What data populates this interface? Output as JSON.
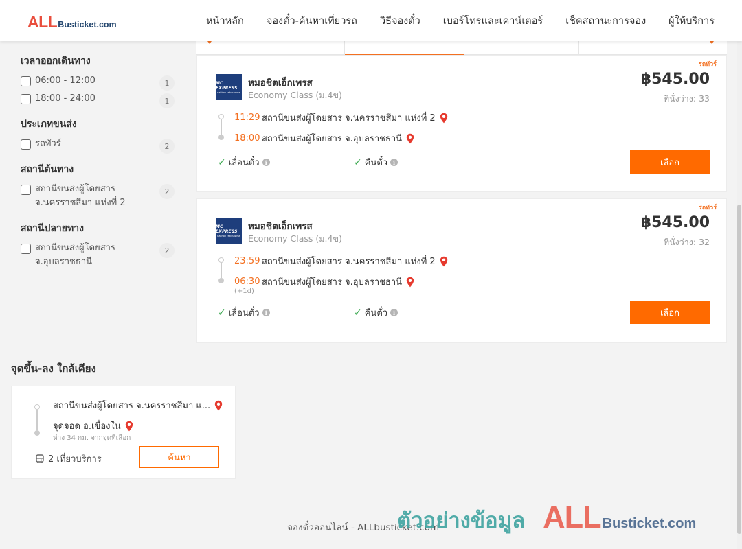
{
  "header": {
    "logo_all": "ALL",
    "logo_rest": "Busticket.com",
    "nav": [
      "หน้าหลัก",
      "จองตั๋ว-ค้นหาเที่ยวรถ",
      "วิธีจองตั๋ว",
      "เบอร์โทรและเคาน์เตอร์",
      "เช็คสถานะการจอง",
      "ผู้ให้บริการ"
    ]
  },
  "filters": {
    "departure_time": {
      "title": "เวลาออกเดินทาง",
      "options": [
        {
          "label": "06:00 - 12:00",
          "count": "1"
        },
        {
          "label": "18:00 - 24:00",
          "count": "1"
        }
      ]
    },
    "transport_type": {
      "title": "ประเภทขนส่ง",
      "options": [
        {
          "label": "รถทัวร์",
          "count": "2"
        }
      ]
    },
    "origin": {
      "title": "สถานีต้นทาง",
      "options": [
        {
          "label": "สถานีขนส่งผู้โดยสาร จ.นครราชสีมา แห่งที่ 2",
          "count": "2"
        }
      ]
    },
    "destination": {
      "title": "สถานีปลายทาง",
      "options": [
        {
          "label": "สถานีขนส่งผู้โดยสาร จ.อุบลราชธานี",
          "count": "2"
        }
      ]
    }
  },
  "trips": [
    {
      "type_badge": "รถทัวร์",
      "operator_logo_l1": "MC EXPRESS",
      "operator_logo_l2": "nakhon ratchasima",
      "operator": "หมอชิตเอ็กเพรส",
      "class": "Economy Class (ม.4ข)",
      "price": "฿545.00",
      "seats": "ที่นั่งว่าง: 33",
      "depart_time": "11:29",
      "depart_station": "สถานีขนส่งผู้โดยสาร จ.นครราชสีมา แห่งที่ 2",
      "arrive_time": "18:00",
      "arrive_station": "สถานีขนส่งผู้โดยสาร จ.อุบลราชธานี",
      "arrive_note": "",
      "feature_1": "เลื่อนตั๋ว",
      "feature_2": "คืนตั๋ว",
      "select_label": "เลือก"
    },
    {
      "type_badge": "รถทัวร์",
      "operator_logo_l1": "MC EXPRESS",
      "operator_logo_l2": "nakhon ratchasima",
      "operator": "หมอชิตเอ็กเพรส",
      "class": "Economy Class (ม.4ข)",
      "price": "฿545.00",
      "seats": "ที่นั่งว่าง: 32",
      "depart_time": "23:59",
      "depart_station": "สถานีขนส่งผู้โดยสาร จ.นครราชสีมา แห่งที่ 2",
      "arrive_time": "06:30",
      "arrive_station": "สถานีขนส่งผู้โดยสาร จ.อุบลราชธานี",
      "arrive_note": "(+1d)",
      "feature_1": "เลื่อนตั๋ว",
      "feature_2": "คืนตั๋ว",
      "select_label": "เลือก"
    }
  ],
  "nearby": {
    "title": "จุดขึ้น-ลง ใกล้เคียง",
    "from": "สถานีขนส่งผู้โดยสาร จ.นครราชสีมา แ...",
    "to": "จุดจอด อ.เขื่องใน",
    "distance": "ห่าง 34 กม. จากจุดที่เลือก",
    "trips": "2 เที่ยวบริการ",
    "search_label": "ค้นหา"
  },
  "footer": {
    "text": "จองตั๋วออนไลน์ - ALLbusticket.com"
  },
  "watermark": {
    "thai": "ตัวอย่างข้อมูล",
    "all": "ALL",
    "rest": "Busticket.com"
  },
  "colors": {
    "accent": "#ff6a00",
    "time_orange": "#f37021",
    "check_green": "#3aa84f",
    "pin_red": "#e63a2e"
  }
}
